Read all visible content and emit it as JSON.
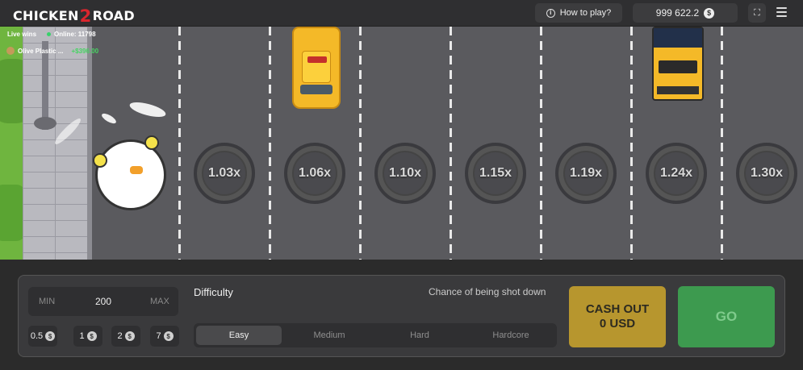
{
  "header": {
    "logo_part1": "CHICKEN",
    "logo_part2": "2",
    "logo_part3": "ROAD",
    "how_to_play": "How to play?",
    "balance": "999 622.2",
    "currency_symbol": "$"
  },
  "live": {
    "live_wins_label": "Live wins",
    "online_label": "Online: 11798",
    "latest_win": {
      "name": "Olive Plastic ...",
      "amount": "+$396.00"
    }
  },
  "lanes": {
    "multipliers": [
      "1.03x",
      "1.06x",
      "1.10x",
      "1.15x",
      "1.19x",
      "1.24x",
      "1.30x"
    ]
  },
  "controls": {
    "min_label": "MIN",
    "max_label": "MAX",
    "bet_value": "200",
    "quick_bets": [
      "0.5",
      "1",
      "2",
      "7"
    ],
    "difficulty_label": "Difficulty",
    "chance_label": "Chance of being shot down",
    "difficulty_options": [
      "Easy",
      "Medium",
      "Hard",
      "Hardcore"
    ],
    "selected_difficulty": "Easy",
    "cashout_line1": "CASH OUT",
    "cashout_line2": "0 USD",
    "go_label": "GO"
  },
  "colors": {
    "accent_gold": "#b7962e",
    "accent_green": "#3d9a4f",
    "online_dot": "#38d16a"
  }
}
